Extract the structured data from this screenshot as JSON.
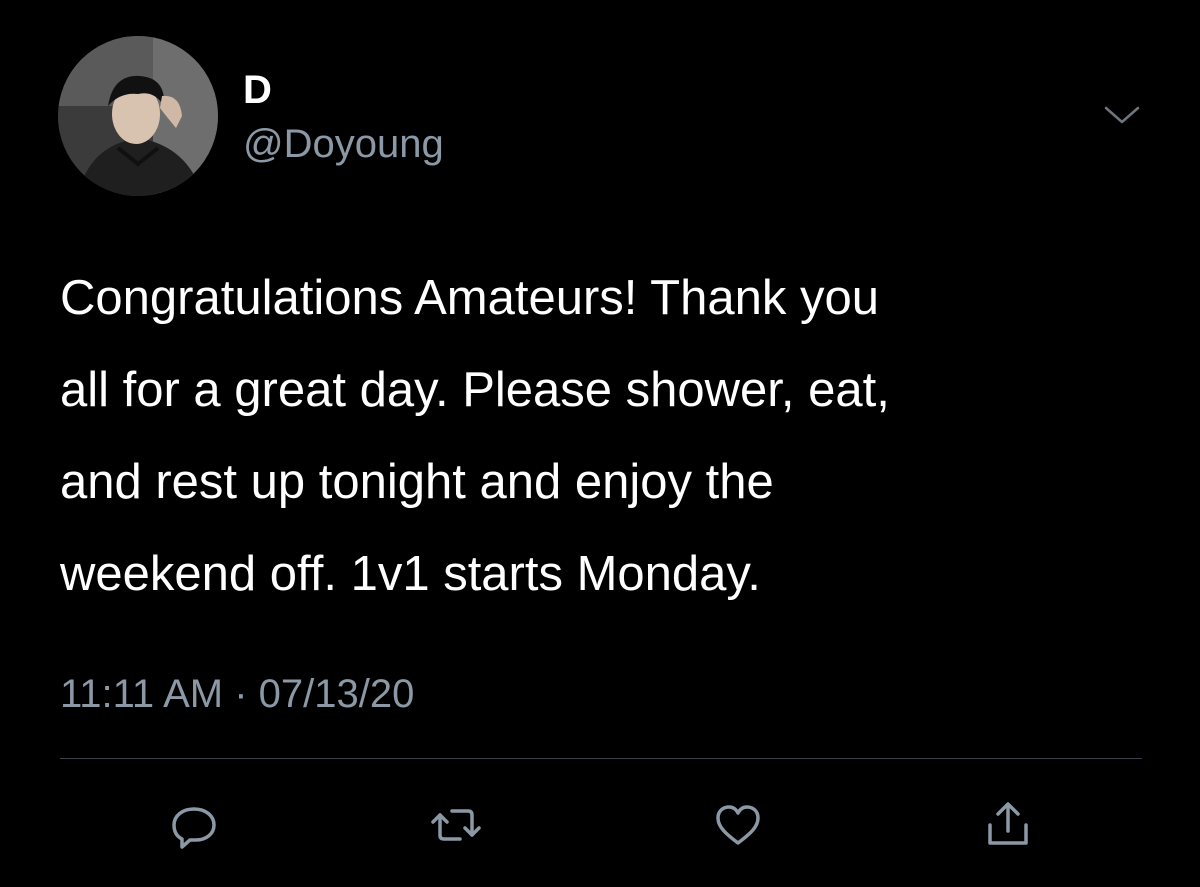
{
  "user": {
    "display_name": "D",
    "handle": "@Doyoung"
  },
  "tweet": {
    "text": "Congratulations Amateurs! Thank you\nall for a great day. Please shower, eat,\nand rest up tonight and enjoy the\nweekend off. 1v1 starts Monday.",
    "time": "11:11 AM",
    "separator": "·",
    "date": "07/13/20"
  },
  "icons": {
    "menu": "chevron-down-icon",
    "reply": "reply-icon",
    "retweet": "retweet-icon",
    "like": "heart-icon",
    "share": "share-icon"
  },
  "colors": {
    "background": "#000000",
    "text": "#ffffff",
    "secondary": "#8b98a5",
    "divider": "#38444d"
  }
}
